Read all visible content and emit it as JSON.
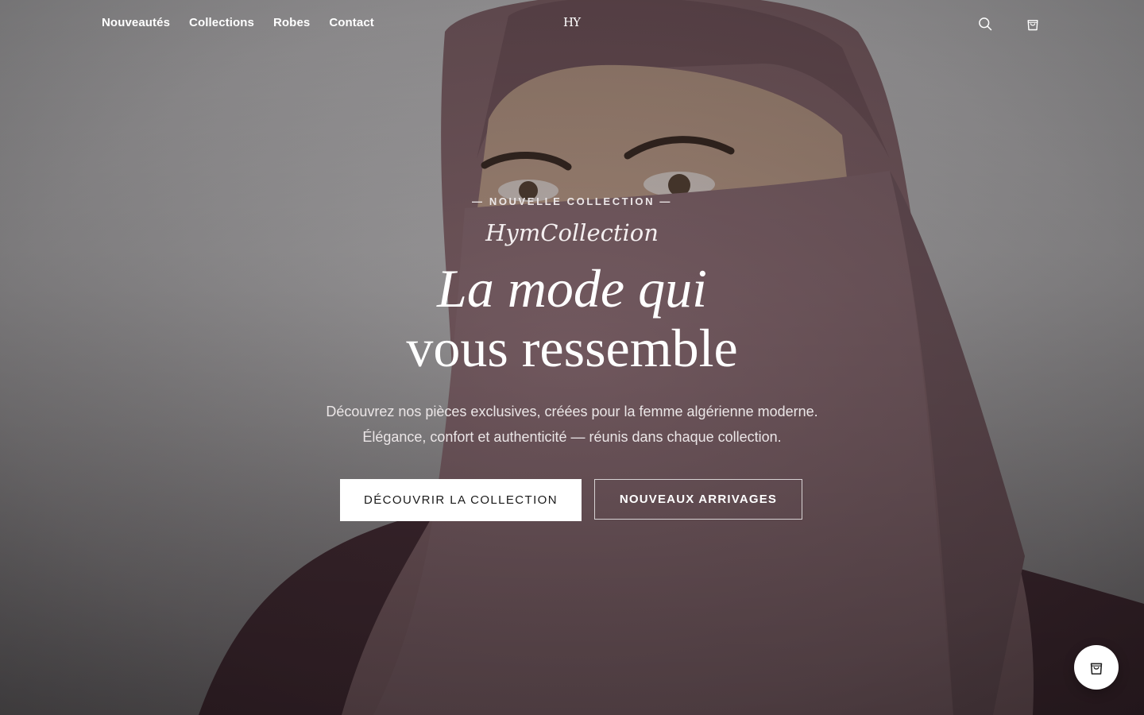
{
  "header": {
    "nav": [
      {
        "label": "Nouveautés"
      },
      {
        "label": "Collections"
      },
      {
        "label": "Robes"
      },
      {
        "label": "Contact"
      }
    ],
    "logo_text": "HY",
    "icons": {
      "search": "search-icon",
      "cart": "shopping-bag-icon"
    }
  },
  "hero": {
    "eyebrow": "— NOUVELLE COLLECTION —",
    "brand": "HymCollection",
    "headline_line1": "La mode qui",
    "headline_line2": "vous ressemble",
    "subtitle_line1": "Découvrez nos pièces exclusives, créées pour la femme algérienne moderne.",
    "subtitle_line2": "Élégance, confort et authenticité — réunis dans chaque collection.",
    "cta_primary": "DÉCOUVRIR LA COLLECTION",
    "cta_secondary": "NOUVEAUX ARRIVAGES"
  },
  "floating": {
    "cart_icon": "shopping-bag-icon"
  },
  "colors": {
    "text": "#ffffff",
    "primary_button_bg": "#ffffff",
    "primary_button_text": "#1a1a1a",
    "hijab": "#8a6a70",
    "background": "#c9c9ca"
  }
}
